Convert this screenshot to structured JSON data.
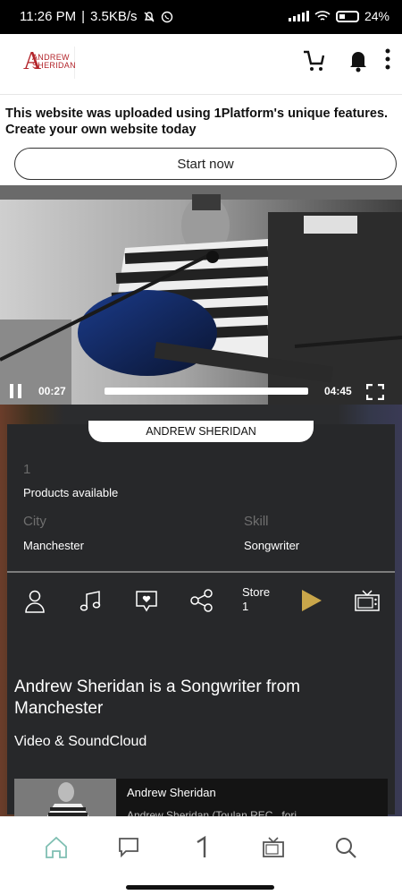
{
  "status_bar": {
    "time": "11:26 PM",
    "net_speed": "3.5KB/s",
    "battery": "24"
  },
  "header": {
    "logo_letter": "A",
    "logo_text": "ANDREW SHERIDAN"
  },
  "promo": {
    "text": "This website was uploaded using 1Platform's unique features. Create your own website today",
    "button_label": "Start now"
  },
  "video": {
    "current_time": "00:27",
    "duration": "04:45",
    "progress": 0.09
  },
  "profile": {
    "name": "ANDREW SHERIDAN",
    "products_count": "1",
    "products_label": "Products available",
    "city_label": "City",
    "city_value": "Manchester",
    "skill_label": "Skill",
    "skill_value": "Songwriter",
    "store_label": "Store",
    "store_count": "1"
  },
  "content": {
    "headline": "Andrew Sheridan is a Songwriter from Manchester",
    "section_title": "Video & SoundCloud",
    "media_title": "Andrew Sheridan",
    "media_desc": "Andrew Sheridan (Toulan REC...fori"
  },
  "colors": {
    "accent_play": "#c9a64a",
    "card_bg": "#27282a",
    "home_active": "#7fbfb2"
  },
  "icons": [
    "cart-icon",
    "bell-icon",
    "more-vertical-icon",
    "pause-icon",
    "fullscreen-icon",
    "user-icon",
    "music-note-icon",
    "heart-message-icon",
    "share-icon",
    "play-icon",
    "tv-icon",
    "home-icon",
    "chat-icon",
    "platform-icon",
    "search-icon"
  ]
}
